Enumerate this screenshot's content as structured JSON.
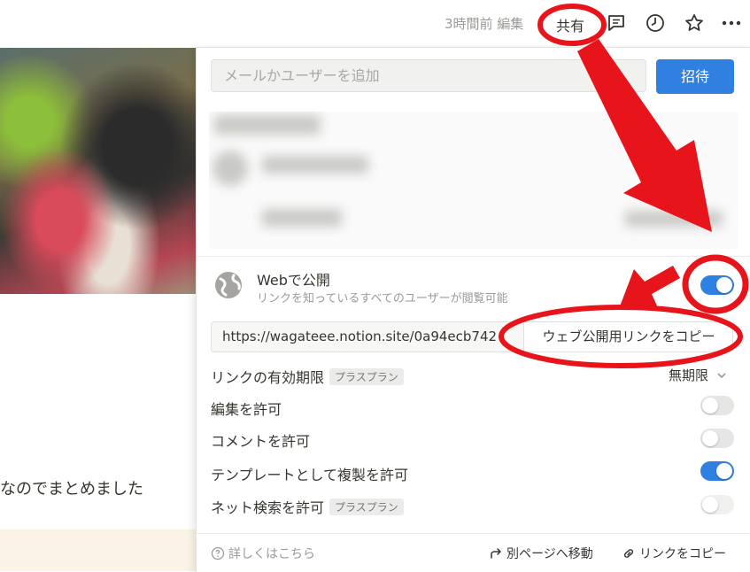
{
  "topbar": {
    "edited": "3時間前 編集",
    "share": "共有",
    "icons": [
      "comment-icon",
      "clock-icon",
      "star-icon",
      "more-icon"
    ]
  },
  "page": {
    "body_text": "なのでまとめました"
  },
  "share_popup": {
    "invite_placeholder": "メールかユーザーを追加",
    "invite_button": "招待",
    "publish": {
      "title": "Webで公開",
      "subtitle": "リンクを知っているすべてのユーザーが閲覧可能",
      "enabled": true
    },
    "url": "https://wagateee.notion.site/0a94ecb742",
    "copy_web_link": "ウェブ公開用リンクをコピー",
    "options": {
      "expiry_label": "リンクの有効期限",
      "expiry_badge": "プラスプラン",
      "expiry_value": "無期限",
      "allow_edit": "編集を許可",
      "allow_edit_on": false,
      "allow_comment": "コメントを許可",
      "allow_comment_on": false,
      "allow_duplicate": "テンプレートとして複製を許可",
      "allow_duplicate_on": true,
      "allow_search": "ネット検索を許可",
      "allow_search_badge": "プラスプラン",
      "allow_search_on": false
    },
    "footer": {
      "learn_more": "詳しくはこちら",
      "move_page": "別ページへ移動",
      "copy_link": "リンクをコピー"
    }
  },
  "colors": {
    "accent": "#2f80e0",
    "annotation": "#e8141c",
    "cream": "#fbf3e5"
  }
}
